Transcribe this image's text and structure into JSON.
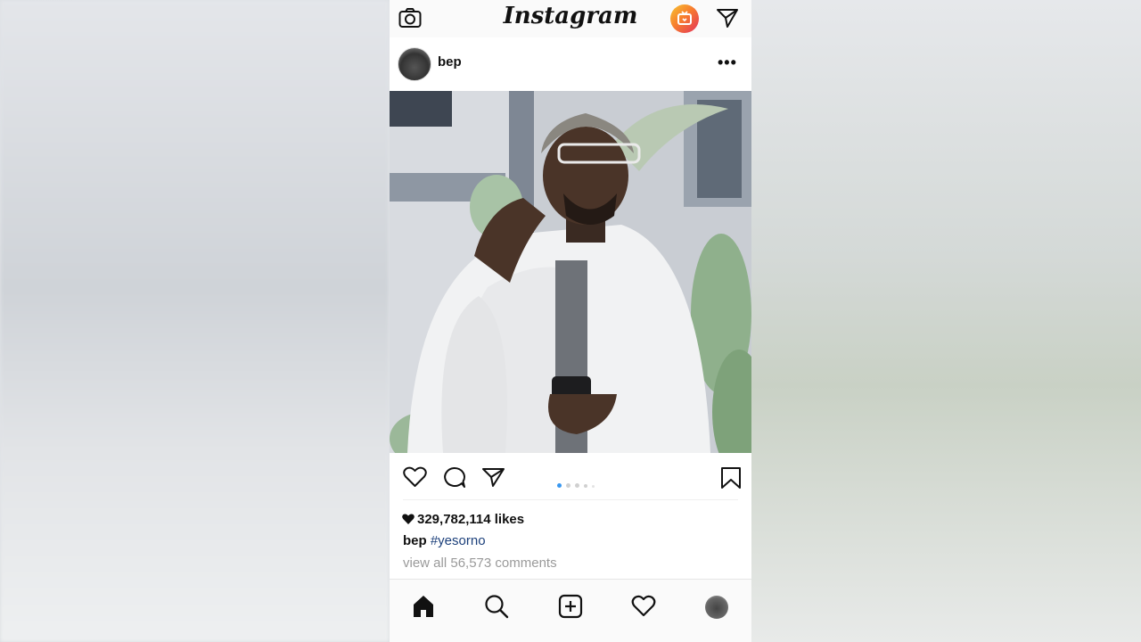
{
  "header": {
    "logo_text": "Instagram",
    "camera_icon": "camera-icon",
    "igtv_icon": "igtv-icon",
    "direct_icon": "paper-plane-icon"
  },
  "post": {
    "username": "bep",
    "more_label": "•••",
    "likes_label": "329,782,114 likes",
    "caption_user": "bep",
    "caption_text": "#yesorno",
    "comments_label": "view all 56,573 comments",
    "carousel_dots": 5,
    "active_dot_index": 0
  },
  "colors": {
    "accent_blue": "#3897f0",
    "hashtag": "#1b3f7a",
    "muted_text": "#9a9a9a"
  },
  "bottom_nav": {
    "items": [
      "home-icon",
      "search-icon",
      "add-post-icon",
      "activity-heart-icon",
      "profile-avatar"
    ]
  }
}
